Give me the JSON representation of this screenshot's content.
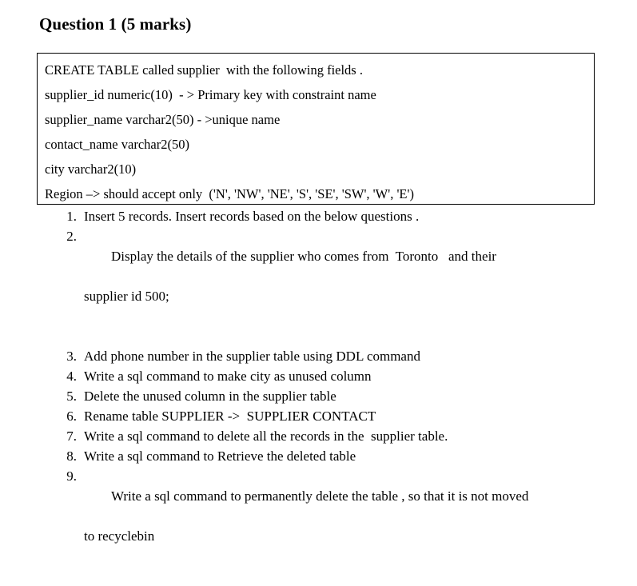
{
  "document": {
    "title": "Question 1 (5 marks)",
    "spec_box": {
      "lines": [
        "CREATE TABLE called supplier  with the following fields .",
        "supplier_id numeric(10)  - > Primary key with constraint name",
        "supplier_name varchar2(50) - >unique name",
        "contact_name varchar2(50)",
        "city varchar2(10)",
        "Region –> should accept only  ('N', 'NW', 'NE', 'S', 'SE', 'SW', 'W', 'E')"
      ]
    },
    "questions": [
      {
        "number": "1.",
        "text": "Insert 5 records. Insert records based on the below questions ."
      },
      {
        "number": "2.",
        "text": "Display the details of the supplier who comes from  Toronto   and their",
        "continuation": "supplier id 500;"
      },
      {
        "number": "3.",
        "text": "Add phone number in the supplier table using DDL command"
      },
      {
        "number": "4.",
        "text": "Write a sql command to make city as unused column"
      },
      {
        "number": "5.",
        "text": "Delete the unused column in the supplier table"
      },
      {
        "number": "6.",
        "text": "Rename table SUPPLIER ->  SUPPLIER CONTACT"
      },
      {
        "number": "7.",
        "text": "Write a sql command to delete all the records in the  supplier table."
      },
      {
        "number": "8.",
        "text": "Write a sql command to Retrieve the deleted table"
      },
      {
        "number": "9.",
        "text": "Write a sql command to permanently delete the table , so that it is not moved",
        "continuation": "to recyclebin"
      }
    ]
  }
}
